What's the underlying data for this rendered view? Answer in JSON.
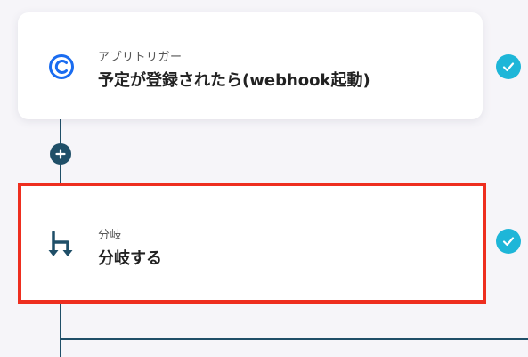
{
  "steps": [
    {
      "category": "アプリトリガー",
      "title": "予定が登録されたら(webhook起動)",
      "icon": "calendly-icon",
      "status": "completed"
    },
    {
      "category": "分岐",
      "title": "分岐する",
      "icon": "branch-icon",
      "status": "completed"
    }
  ],
  "colors": {
    "connector": "#1f4f68",
    "check": "#1eb6d8",
    "highlight": "#ee2e1f",
    "brand": "#1a6cf0"
  }
}
